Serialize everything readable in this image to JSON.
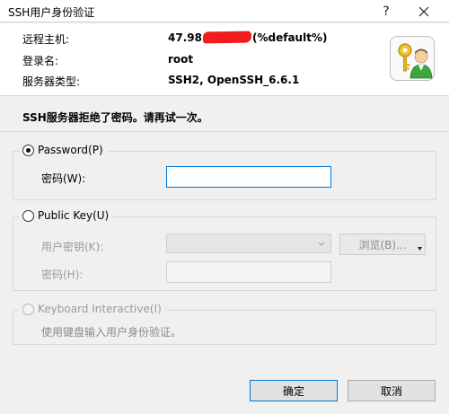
{
  "window": {
    "title": "SSH用户身份验证",
    "help_label": "?"
  },
  "header": {
    "host_label": "远程主机:",
    "host_value_prefix": "47.98.",
    "host_value_suffix": "(%default%)",
    "login_label": "登录名:",
    "login_value": "root",
    "server_type_label": "服务器类型:",
    "server_type_value": "SSH2, OpenSSH_6.6.1",
    "icon": "keys-icon"
  },
  "status_message": "SSH服务器拒绝了密码。请再试一次。",
  "password_group": {
    "label": "Password(P)",
    "selected": true,
    "password_label": "密码(W):",
    "password_value": ""
  },
  "publickey_group": {
    "label": "Public Key(U)",
    "selected": false,
    "user_key_label": "用户密钥(K):",
    "browse_label": "浏览(B)...",
    "passphrase_label": "密码(H):"
  },
  "keyboard_group": {
    "label": "Keyboard Interactive(I)",
    "selected": false,
    "hint": "使用键盘输入用户身份验证。"
  },
  "buttons": {
    "ok_label": "确定",
    "cancel_label": "取消"
  },
  "colors": {
    "accent": "#0078d7",
    "redaction": "#ef1d1d"
  }
}
